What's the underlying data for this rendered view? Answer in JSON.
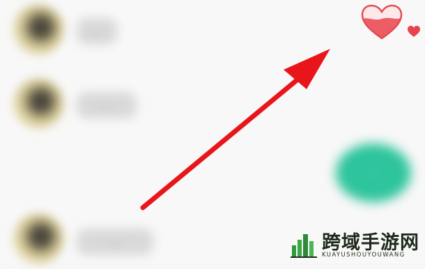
{
  "contacts": [
    {
      "name": "..."
    },
    {
      "name": "..."
    },
    {
      "name": "..."
    }
  ],
  "action": {
    "label": "..."
  },
  "icons": {
    "like": "heart-icon",
    "like_small": "small-heart-icon",
    "pointer": "red-arrow"
  },
  "watermark": {
    "title": "跨域手游网",
    "subtitle": "KUAYUSHOUYOUWANG"
  },
  "colors": {
    "arrow": "#e8161b",
    "heart": "#ec5d66",
    "action": "#2ec49c",
    "background": "#f8f8f8"
  }
}
